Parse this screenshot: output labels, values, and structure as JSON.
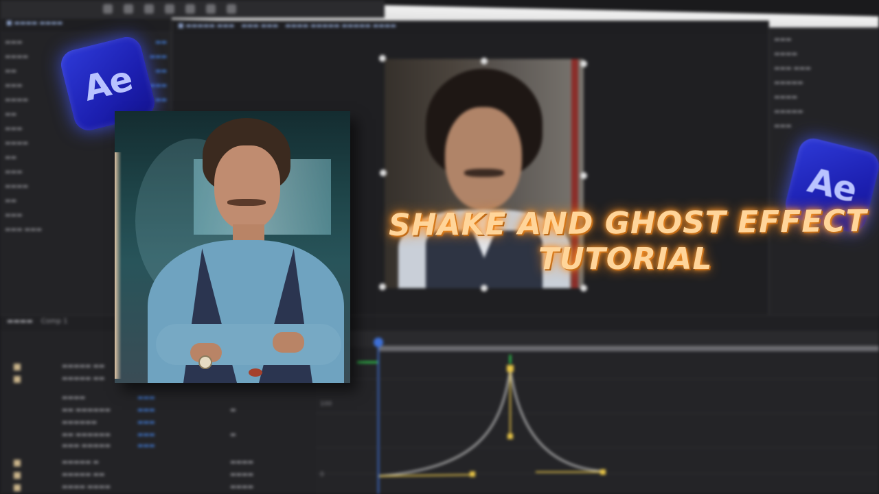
{
  "thumbnail": {
    "title_line_1": "SHAKE AND GHOST EFFECT",
    "title_line_2": "TUTORIAL",
    "logo_text": "Ae",
    "title_color": "#ffd59a",
    "glow_color": "#ff8a1a",
    "logo_color": "#1c1fb0"
  },
  "app": {
    "timeline_tab": "Comp 1",
    "graph_labels": [
      "0",
      "100"
    ]
  }
}
